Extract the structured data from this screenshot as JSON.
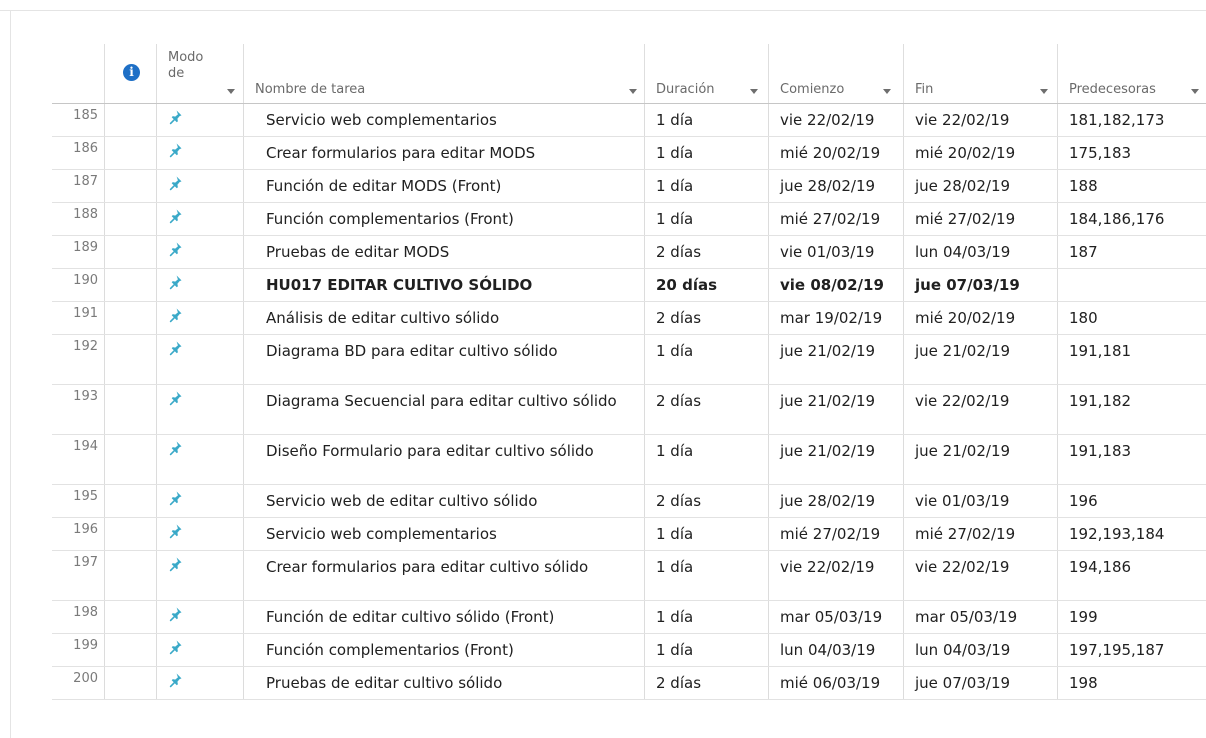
{
  "headers": {
    "info_icon": "i",
    "modo_line1": "Modo",
    "modo_line2": "de",
    "nombre": "Nombre de tarea",
    "duracion": "Duración",
    "comienzo": "Comienzo",
    "fin": "Fin",
    "predecesoras": "Predecesoras"
  },
  "icons": {
    "mode": "pin-icon",
    "info": "info-icon"
  },
  "colors": {
    "pin": "#3aa9c8",
    "info": "#1e6fc6"
  },
  "rows": [
    {
      "id": "185",
      "name": "Servicio web complementarios",
      "duration": "1 día",
      "start": "vie 22/02/19",
      "end": "vie 22/02/19",
      "pred": "181,182,173",
      "bold": false,
      "tall": false
    },
    {
      "id": "186",
      "name": "Crear formularios para editar MODS",
      "duration": "1 día",
      "start": "mié 20/02/19",
      "end": "mié 20/02/19",
      "pred": "175,183",
      "bold": false,
      "tall": false
    },
    {
      "id": "187",
      "name": "Función de editar MODS (Front)",
      "duration": "1 día",
      "start": "jue 28/02/19",
      "end": "jue 28/02/19",
      "pred": "188",
      "bold": false,
      "tall": false
    },
    {
      "id": "188",
      "name": "Función complementarios (Front)",
      "duration": "1 día",
      "start": "mié 27/02/19",
      "end": "mié 27/02/19",
      "pred": "184,186,176",
      "bold": false,
      "tall": false
    },
    {
      "id": "189",
      "name": "Pruebas de editar MODS",
      "duration": "2 días",
      "start": "vie 01/03/19",
      "end": "lun 04/03/19",
      "pred": "187",
      "bold": false,
      "tall": false
    },
    {
      "id": "190",
      "name": "HU017 EDITAR CULTIVO SÓLIDO",
      "duration": "20 días",
      "start": "vie 08/02/19",
      "end": "jue 07/03/19",
      "pred": "",
      "bold": true,
      "tall": false
    },
    {
      "id": "191",
      "name": "Análisis de editar cultivo sólido",
      "duration": "2 días",
      "start": "mar 19/02/19",
      "end": "mié 20/02/19",
      "pred": "180",
      "bold": false,
      "tall": false
    },
    {
      "id": "192",
      "name": "Diagrama BD para editar cultivo sólido",
      "duration": "1 día",
      "start": "jue 21/02/19",
      "end": "jue 21/02/19",
      "pred": "191,181",
      "bold": false,
      "tall": true
    },
    {
      "id": "193",
      "name": "Diagrama Secuencial para editar cultivo sólido",
      "duration": "2 días",
      "start": "jue 21/02/19",
      "end": "vie 22/02/19",
      "pred": "191,182",
      "bold": false,
      "tall": true
    },
    {
      "id": "194",
      "name": "Diseño Formulario para editar cultivo sólido",
      "duration": "1 día",
      "start": "jue 21/02/19",
      "end": "jue 21/02/19",
      "pred": "191,183",
      "bold": false,
      "tall": true
    },
    {
      "id": "195",
      "name": "Servicio web de editar cultivo sólido",
      "duration": "2 días",
      "start": "jue 28/02/19",
      "end": "vie 01/03/19",
      "pred": "196",
      "bold": false,
      "tall": false
    },
    {
      "id": "196",
      "name": "Servicio web complementarios",
      "duration": "1 día",
      "start": "mié 27/02/19",
      "end": "mié 27/02/19",
      "pred": "192,193,184",
      "bold": false,
      "tall": false
    },
    {
      "id": "197",
      "name": "Crear formularios para editar cultivo sólido",
      "duration": "1 día",
      "start": "vie 22/02/19",
      "end": "vie 22/02/19",
      "pred": "194,186",
      "bold": false,
      "tall": true
    },
    {
      "id": "198",
      "name": "Función de editar cultivo sólido (Front)",
      "duration": "1 día",
      "start": "mar 05/03/19",
      "end": "mar 05/03/19",
      "pred": "199",
      "bold": false,
      "tall": false
    },
    {
      "id": "199",
      "name": "Función complementarios (Front)",
      "duration": "1 día",
      "start": "lun 04/03/19",
      "end": "lun 04/03/19",
      "pred": "197,195,187",
      "bold": false,
      "tall": false
    },
    {
      "id": "200",
      "name": "Pruebas de editar cultivo sólido",
      "duration": "2 días",
      "start": "mié 06/03/19",
      "end": "jue 07/03/19",
      "pred": "198",
      "bold": false,
      "tall": false
    }
  ]
}
